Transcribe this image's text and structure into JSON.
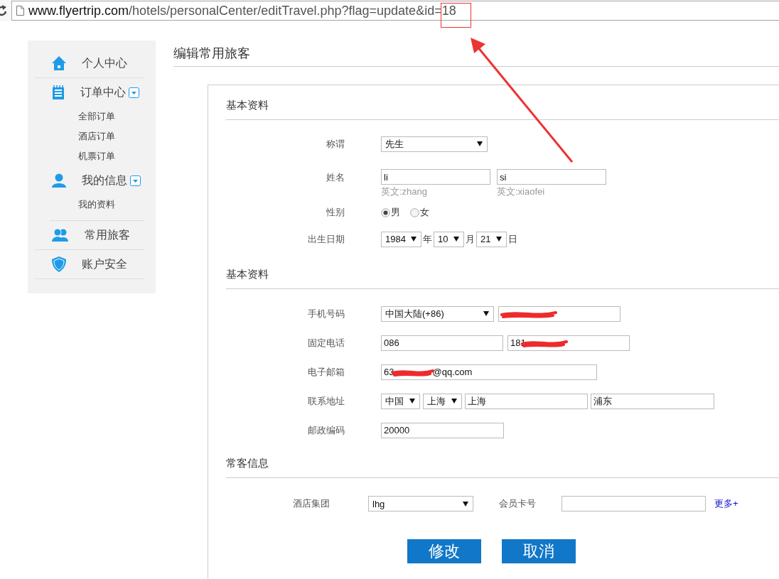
{
  "address_bar": {
    "host": "www.flyertrip.com",
    "path": "/hotels/personalCenter/editTravel.php?flag=update&id=18"
  },
  "sidebar": {
    "items": [
      {
        "label": "个人中心"
      },
      {
        "label": "订单中心",
        "expanded": true,
        "children": [
          {
            "label": "全部订单"
          },
          {
            "label": "酒店订单"
          },
          {
            "label": "机票订单"
          }
        ]
      },
      {
        "label": "我的信息",
        "expanded": true,
        "children": [
          {
            "label": "我的资料"
          }
        ]
      },
      {
        "label": "常用旅客"
      },
      {
        "label": "账户安全"
      }
    ]
  },
  "title": "编辑常用旅客",
  "sections": [
    {
      "heading": "基本资料",
      "rows": [
        {
          "kind": "select",
          "label": "称谓",
          "value": "先生"
        },
        {
          "kind": "name",
          "label": "姓名",
          "fields": [
            {
              "value": "li",
              "note": "英文:zhang"
            },
            {
              "value": "si",
              "note": "英文:xiaofei"
            }
          ]
        },
        {
          "kind": "radio",
          "label": "性别",
          "options": [
            {
              "label": "男",
              "selected": true
            },
            {
              "label": "女",
              "selected": false
            }
          ]
        },
        {
          "kind": "date",
          "label": "出生日期",
          "parts": [
            {
              "value": "1984",
              "unit": "年"
            },
            {
              "value": "10",
              "unit": "月"
            },
            {
              "value": "21",
              "unit": "日"
            }
          ]
        }
      ]
    },
    {
      "heading": "基本资料",
      "rows": [
        {
          "kind": "phone",
          "label": "手机号码",
          "region": "中国大陆(+86)",
          "redacted": true
        },
        {
          "kind": "landline",
          "label": "固定电话",
          "area": "086",
          "prefix": "181",
          "redacted": true
        },
        {
          "kind": "email",
          "label": "电子邮箱",
          "prefix": "63",
          "suffix": "@qq.com",
          "redacted": true
        },
        {
          "kind": "address",
          "label": "联系地址",
          "country": "中国",
          "province": "上海",
          "city": "上海",
          "district": "浦东"
        },
        {
          "kind": "text",
          "label": "邮政编码",
          "value": "20000"
        }
      ]
    },
    {
      "heading": "常客信息",
      "rows": [
        {
          "kind": "hotel",
          "label": "酒店集团",
          "value": "lhg",
          "card_label": "会员卡号",
          "more": "更多+"
        }
      ]
    }
  ],
  "buttons": [
    {
      "label": "修改"
    },
    {
      "label": "取消"
    }
  ]
}
